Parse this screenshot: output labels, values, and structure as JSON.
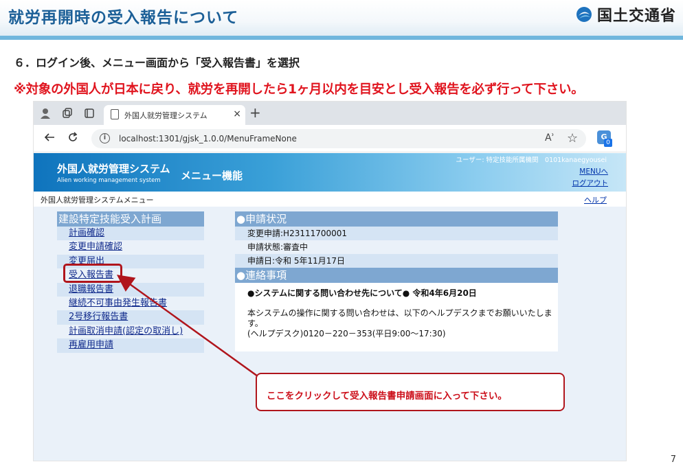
{
  "slide": {
    "title": "就労再開時の受入報告について",
    "logo_text": "国土交通省",
    "step": "６．ログイン後、メニュー画面から「受入報告書」を選択",
    "warning": "※対象の外国人が日本に戻り、就労を再開したら1ヶ月以内を目安とし受入報告を必ず行って下さい。",
    "page_number": "7",
    "callout": "ここをクリックして受入報告書申請画面に入って下さい。"
  },
  "browser": {
    "tab_title": "外国人就労管理システム",
    "tab_close": "×",
    "new_tab": "+",
    "url": "localhost:1301/gjsk_1.0.0/MenuFrameNone",
    "read_aloud": "Aʾ",
    "extension_badge": "0"
  },
  "app": {
    "name": "外国人就労管理システム",
    "name_en": "Alien working management system",
    "menu_title": "メニュー機能",
    "user_line": "ユーザー: 特定技能所属機関　0101kanaegyousei",
    "menu_link": "MENUへ",
    "logout_link": "ログアウト",
    "breadcrumb": "外国人就労管理システムメニュー",
    "help_link": "ヘルプ"
  },
  "left_menu": {
    "header": "建設特定技能受入計画",
    "items": [
      "計画確認",
      "変更申請確認",
      "変更届出",
      "受入報告書",
      "退職報告書",
      "継続不可事由発生報告書",
      "2号移行報告書",
      "計画取消申請(認定の取消し)",
      "再雇用申請"
    ]
  },
  "status": {
    "header": "●申請状況",
    "rows": [
      "変更申請:H23111700001",
      "申請状態:審査中",
      "申請日:令和 5年11月17日"
    ]
  },
  "contact": {
    "header": "●連絡事項",
    "title": "●システムに関する問い合わせ先について●  令和4年6月20日",
    "body": "本システムの操作に関する問い合わせは、以下のヘルプデスクまでお願いいたします。",
    "helpdesk": "(ヘルプデスク)0120－220－353(平日9:00～17:30)"
  },
  "colors": {
    "accent_red": "#b0151c",
    "warning_red": "#e0141e",
    "title_blue": "#1b5f97",
    "menu_header": "#7ea7d1"
  }
}
